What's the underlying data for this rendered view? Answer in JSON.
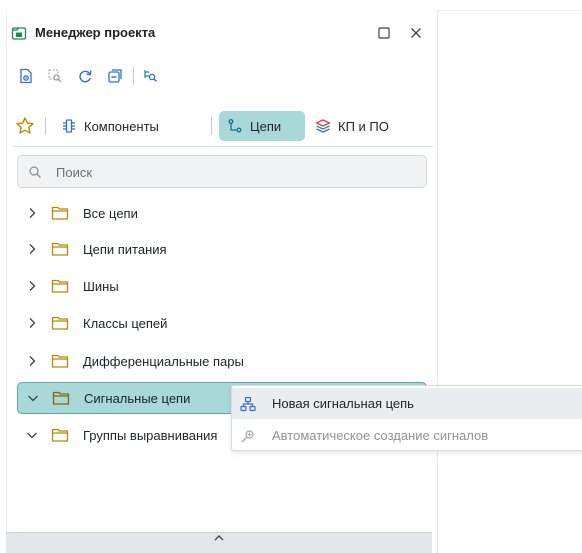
{
  "panel": {
    "title": "Менеджер проекта",
    "maximize_icon": "maximize-icon",
    "close_icon": "close-icon"
  },
  "toolbar": {
    "icons": [
      "document-preview-icon",
      "zoom-select-icon",
      "refresh-icon",
      "collapse-all-icon",
      "zoom-fit-icon"
    ]
  },
  "tabs": {
    "favorites_icon": "star-icon",
    "items": [
      {
        "label": "Компоненты",
        "icon": "component-icon",
        "active": false
      },
      {
        "label": "Цепи",
        "icon": "net-icon",
        "active": true
      },
      {
        "label": "КП и ПО",
        "icon": "layers-icon",
        "active": false
      }
    ]
  },
  "search": {
    "placeholder": "Поиск",
    "value": ""
  },
  "tree": {
    "items": [
      {
        "label": "Все цепи",
        "expanded": false
      },
      {
        "label": "Цепи питания",
        "expanded": false
      },
      {
        "label": "Шины",
        "expanded": false
      },
      {
        "label": "Классы цепей",
        "expanded": false
      },
      {
        "label": "Дифференциальные пары",
        "expanded": false
      },
      {
        "label": "Сигнальные цепи",
        "expanded": true,
        "selected": true
      },
      {
        "label": "Группы выравнивания",
        "expanded": true
      }
    ]
  },
  "context_menu": {
    "items": [
      {
        "label": "Новая сигнальная цепь",
        "icon": "new-signal-net-icon",
        "enabled": true
      },
      {
        "label": "Автоматическое создание сигналов",
        "icon": "auto-create-icon",
        "enabled": false
      }
    ]
  },
  "colors": {
    "accent": "#a8d8d8",
    "accent_border": "#5fa6a6",
    "folder": "#b8860b",
    "icon_blue": "#2f6fd6",
    "icon_teal": "#1c8a8a"
  }
}
